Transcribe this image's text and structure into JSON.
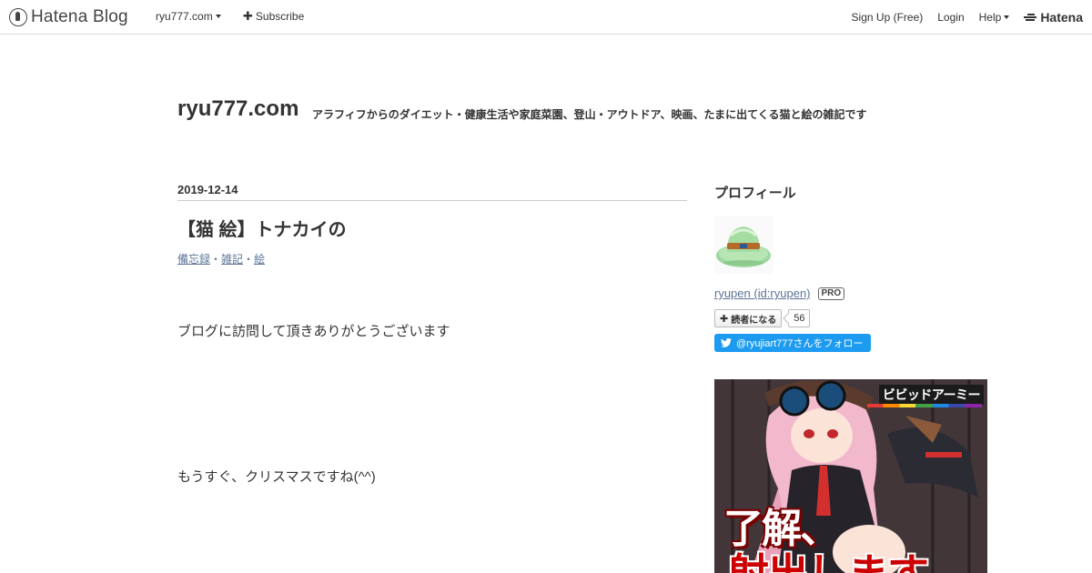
{
  "header": {
    "logo_text": "Hatena Blog",
    "blog_menu": "ryu777.com",
    "subscribe": "Subscribe",
    "signup": "Sign Up (Free)",
    "login": "Login",
    "help": "Help",
    "hatena": "Hatena"
  },
  "blog": {
    "title": "ryu777.com",
    "description": "アラフィフからのダイエット・健康生活や家庭菜園、登山・アウトドア、映画、たまに出てくる猫と絵の雑記です"
  },
  "entry": {
    "date": "2019-12-14",
    "title": "【猫 絵】トナカイの",
    "categories": [
      "備忘録",
      "雑記",
      "絵"
    ],
    "paragraph1": "ブログに訪問して頂きありがとうございます",
    "paragraph2": "もうすぐ、クリスマスですね(^^)"
  },
  "sidebar": {
    "profile_title": "プロフィール",
    "user_link": "ryupen (id:ryupen)",
    "pro_badge": "PRO",
    "reader_button": "読者になる",
    "reader_count": "56",
    "follow_button": "@ryujiart777さんをフォロー"
  },
  "ad": {
    "logo_text": "ビビッドアーミー",
    "headline1": "了解、",
    "headline2": "射出します…"
  },
  "colors": {
    "link": "#5a7497",
    "twitter": "#1d9bf0",
    "border": "#dddddd"
  }
}
